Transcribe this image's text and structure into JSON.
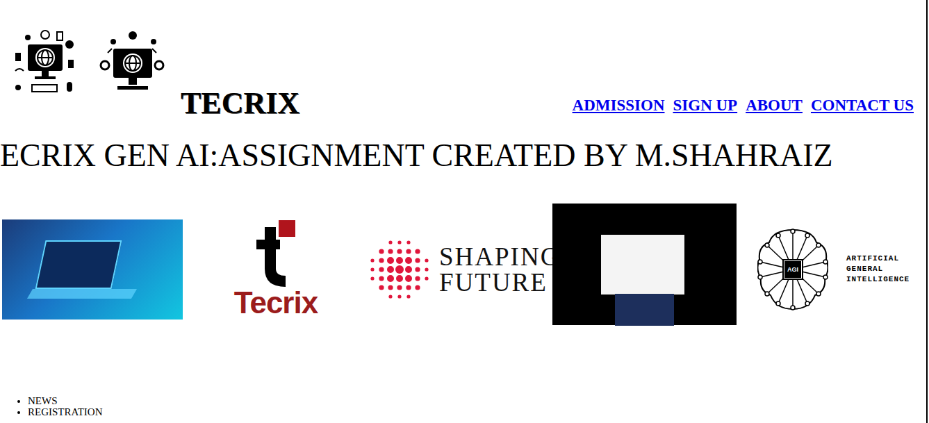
{
  "brand": "TECRIX",
  "nav": [
    {
      "label": "ADMISSION"
    },
    {
      "label": "SIGN UP"
    },
    {
      "label": "ABOUT"
    },
    {
      "label": "CONTACT US"
    }
  ],
  "heading": "ECRIX GEN AI:ASSIGNMENT CREATED BY M.SHAHRAIZ",
  "gallery": [
    {
      "kind": "laptop-photo",
      "texts": []
    },
    {
      "kind": "tecrix-logo",
      "texts": [
        "Tecrix"
      ]
    },
    {
      "kind": "shaping-logo",
      "texts": [
        "SHAPING",
        "FUTURE"
      ]
    },
    {
      "kind": "bye-photo",
      "texts": []
    },
    {
      "kind": "agi-logo",
      "texts": [
        "AGI",
        "ARTIFICIAL",
        "GENERAL",
        "INTELLIGENCE"
      ]
    }
  ],
  "list": [
    "NEWS",
    "REGISTRATION"
  ]
}
